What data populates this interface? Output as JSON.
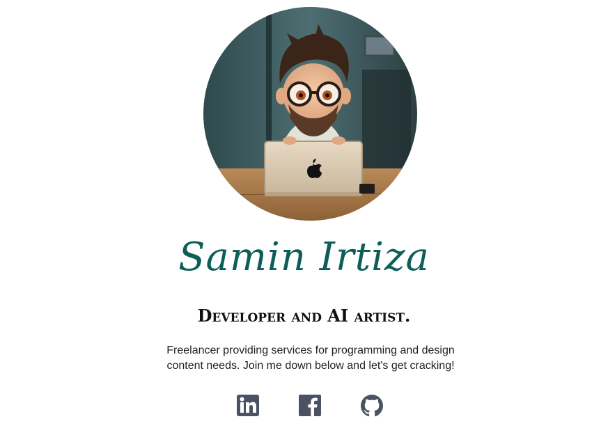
{
  "profile": {
    "name": "Samin Irtiza",
    "tagline": "Developer and AI artist.",
    "description": "Freelancer providing services for programming and design content needs. Join me down below and let's get cracking!",
    "avatar_alt": "Cartoon developer with glasses working on a laptop"
  },
  "colors": {
    "name_accent": "#0d5e58",
    "icon": "#4a5263"
  },
  "socials": [
    {
      "icon": "linkedin-icon"
    },
    {
      "icon": "facebook-icon"
    },
    {
      "icon": "github-icon"
    }
  ]
}
